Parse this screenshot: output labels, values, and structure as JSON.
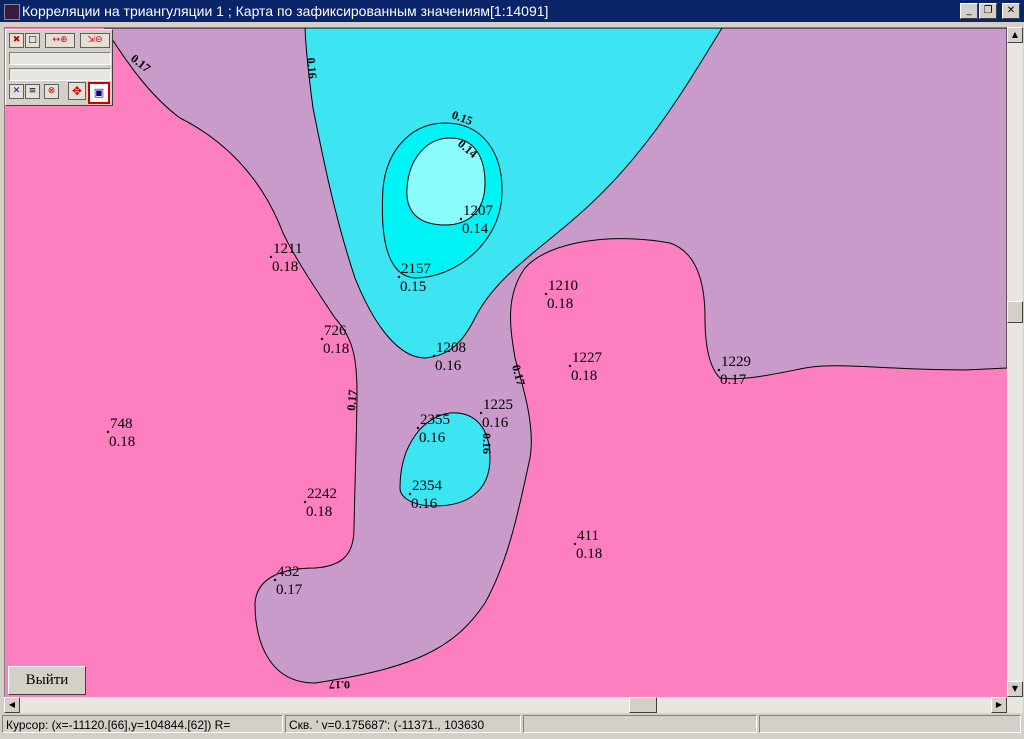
{
  "window": {
    "title": "Корреляции на триангуляции 1  ; Карта по зафиксированным значениям[1:14091]",
    "min_glyph": "_",
    "restore_glyph": "❐",
    "close_glyph": "✕"
  },
  "colors": {
    "title_bar": "#0a246a",
    "zone_018": "#fe7fbf",
    "zone_017": "#c89bcb",
    "zone_016": "#3de5f2",
    "zone_015": "#00f3f5",
    "zone_014": "#8bfcfd"
  },
  "points": [
    {
      "id": "1207",
      "value": "0.14"
    },
    {
      "id": "1211",
      "value": "0.18"
    },
    {
      "id": "2157",
      "value": "0.15"
    },
    {
      "id": "1210",
      "value": "0.18"
    },
    {
      "id": "726",
      "value": "0.18"
    },
    {
      "id": "1208",
      "value": "0.16"
    },
    {
      "id": "1227",
      "value": "0.18"
    },
    {
      "id": "1229",
      "value": "0.17"
    },
    {
      "id": "1225",
      "value": "0.16"
    },
    {
      "id": "748",
      "value": "0.18"
    },
    {
      "id": "2355",
      "value": "0.16"
    },
    {
      "id": "2354",
      "value": "0.16"
    },
    {
      "id": "2242",
      "value": "0.18"
    },
    {
      "id": "411",
      "value": "0.18"
    },
    {
      "id": "432",
      "value": "0.17"
    }
  ],
  "contour_labels": [
    "0.17",
    "0.16",
    "0.15",
    "0.14",
    "0.17",
    "0.17",
    "0.16",
    "0.17"
  ],
  "toolbox": {
    "icons": [
      "zoom-fit-icon",
      "frame-icon",
      "pan-zoom-icon",
      "zoom-out-icon",
      "close-small-icon",
      "list-icon",
      "stop-icon",
      "target-icon",
      "layers-icon"
    ]
  },
  "exit_button": {
    "label": "Выйти"
  },
  "status": {
    "cursor": "Курсор: (x=-11120.[66],y=104844.[62]) R=",
    "well": "Скв. ' v=0.175687': (-11371., 103630"
  }
}
